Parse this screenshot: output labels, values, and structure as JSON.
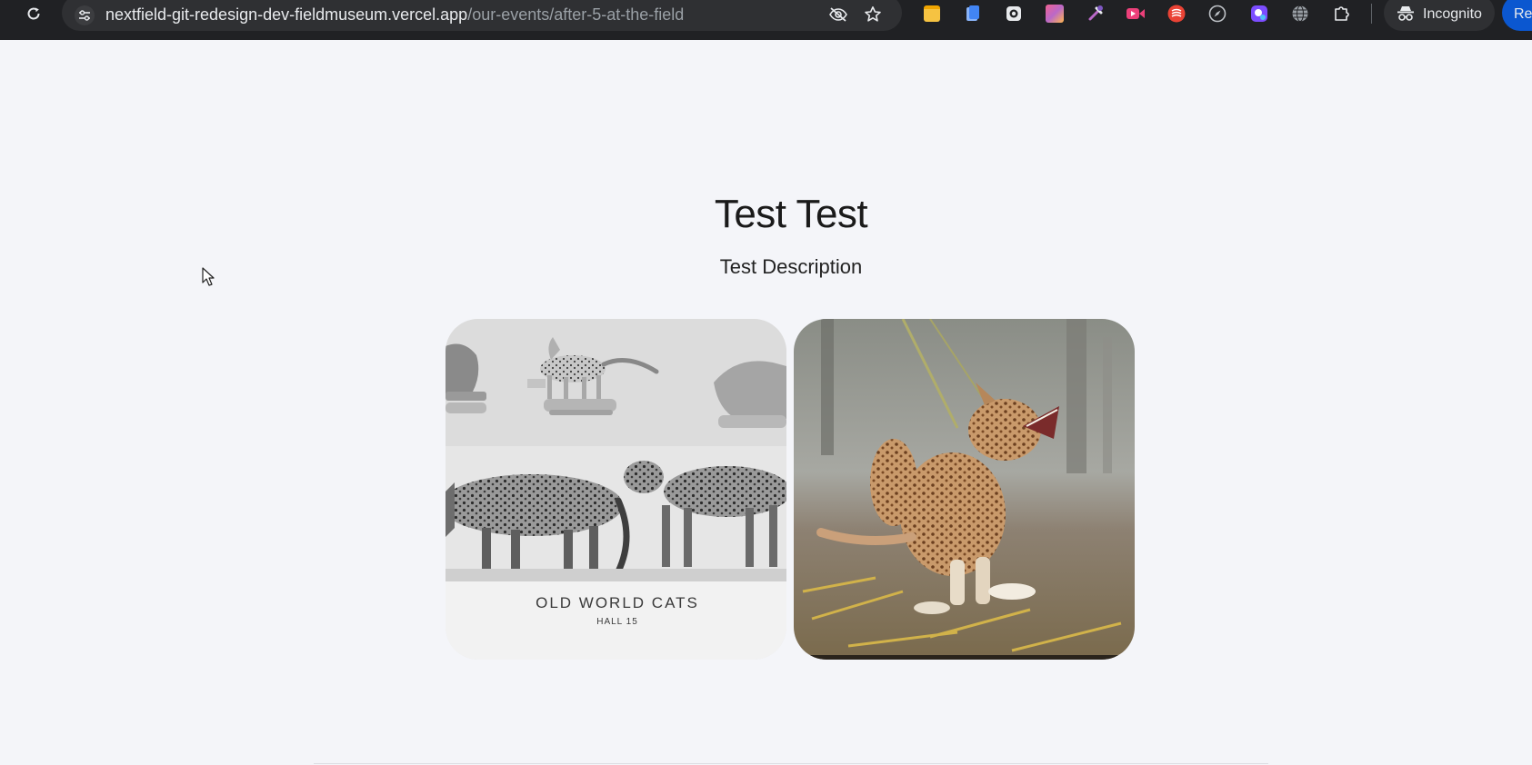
{
  "browser": {
    "url_domain": "nextfield-git-redesign-dev-fieldmuseum.vercel.app",
    "url_path": "/our-events/after-5-at-the-field",
    "incognito_label": "Incognito",
    "profile_label": "Re",
    "icons": {
      "reload": "reload-icon",
      "site_info": "tune-icon",
      "tracking": "eye-off-icon",
      "bookmark": "star-icon"
    },
    "extensions": [
      "notes-extension-icon",
      "clipboard-extension-icon",
      "camera-extension-icon",
      "gradient-extension-icon",
      "eyedropper-extension-icon",
      "video-extension-icon",
      "red-extension-icon",
      "compass-extension-icon",
      "screenshot-extension-icon",
      "globe-extension-icon",
      "puzzle-extensions-icon"
    ],
    "colors": {
      "toolbar_bg": "#202124",
      "omnibox_bg": "#2f3033",
      "profile_bg": "#0b57d0"
    }
  },
  "page": {
    "title": "Test Test",
    "description": "Test Description",
    "background": "#f4f5f9",
    "images": [
      {
        "caption_line1": "OLD  WORLD  CATS",
        "caption_line2": "HALL 15",
        "style": "grayscale museum diorama"
      },
      {
        "caption_line1": "",
        "caption_line2": "",
        "style": "color photo of snarling wild cat"
      }
    ]
  }
}
